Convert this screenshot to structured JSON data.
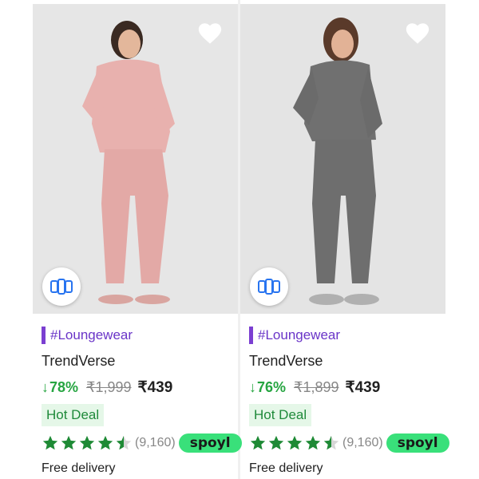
{
  "products": [
    {
      "tag": "#Loungewear",
      "brand": "TrendVerse",
      "discount": "78%",
      "mrp": "₹1,999",
      "price": "₹439",
      "badge": "Hot Deal",
      "rating": 4.5,
      "rating_count": "(9,160)",
      "spoyl_label": "spoyl",
      "delivery": "Free delivery",
      "outfit_color": "#e8b1ae",
      "icons": {
        "wishlist": "heart-outline-icon",
        "similar": "similar-products-icon"
      }
    },
    {
      "tag": "#Loungewear",
      "brand": "TrendVerse",
      "discount": "76%",
      "mrp": "₹1,899",
      "price": "₹439",
      "badge": "Hot Deal",
      "rating": 4.5,
      "rating_count": "(9,160)",
      "spoyl_label": "spoyl",
      "delivery": "Free delivery",
      "outfit_color": "#707070",
      "icons": {
        "wishlist": "heart-outline-icon",
        "similar": "similar-products-icon"
      }
    }
  ],
  "colors": {
    "tag_purple": "#6a35c8",
    "discount_green": "#26a541",
    "star_green": "#1e8a35",
    "spoyl_green": "#39e07a"
  }
}
